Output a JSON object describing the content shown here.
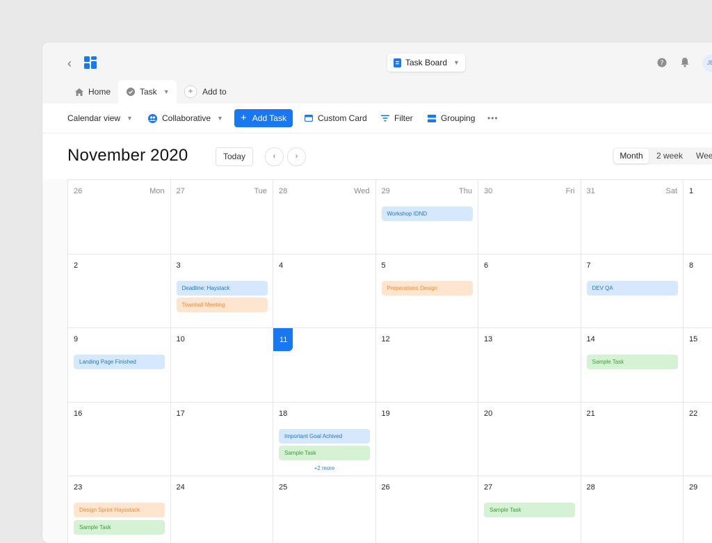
{
  "header": {
    "board_switch_label": "Task Board",
    "avatar_initials": "JB"
  },
  "tabs": {
    "home": "Home",
    "task": "Task",
    "add_to": "Add to"
  },
  "toolbar": {
    "calendar_view": "Calendar view",
    "collaborative": "Collaborative",
    "add_task": "Add Task",
    "custom_card": "Custom Card",
    "filter": "Filter",
    "grouping": "Grouping"
  },
  "calendar": {
    "title": "November 2020",
    "today_button": "Today",
    "views": [
      "Month",
      "2 week",
      "Week"
    ],
    "active_view": "Month",
    "weeks": [
      [
        {
          "day": "26",
          "name": "Mon",
          "dim": true,
          "events": []
        },
        {
          "day": "27",
          "name": "Tue",
          "dim": true,
          "events": []
        },
        {
          "day": "28",
          "name": "Wed",
          "dim": true,
          "events": []
        },
        {
          "day": "29",
          "name": "Thu",
          "dim": true,
          "events": [
            {
              "label": "Workshop IDND",
              "color": "blue"
            }
          ]
        },
        {
          "day": "30",
          "name": "Fri",
          "dim": true,
          "events": []
        },
        {
          "day": "31",
          "name": "Sat",
          "dim": true,
          "events": []
        },
        {
          "day": "1",
          "name": "",
          "dim": false,
          "events": []
        }
      ],
      [
        {
          "day": "2",
          "events": []
        },
        {
          "day": "3",
          "events": [
            {
              "label": "Deadline: Haystack",
              "color": "blue"
            },
            {
              "label": "Townhall Meeting",
              "color": "orange"
            }
          ]
        },
        {
          "day": "4",
          "events": []
        },
        {
          "day": "5",
          "events": [
            {
              "label": "Preperations Design",
              "color": "orange"
            }
          ]
        },
        {
          "day": "6",
          "events": []
        },
        {
          "day": "7",
          "events": [
            {
              "label": "DEV QA",
              "color": "blue"
            }
          ]
        },
        {
          "day": "8",
          "events": []
        }
      ],
      [
        {
          "day": "9",
          "events": [
            {
              "label": "Landing Page Finished",
              "color": "blue"
            }
          ]
        },
        {
          "day": "10",
          "events": []
        },
        {
          "day": "11",
          "today": true,
          "events": []
        },
        {
          "day": "12",
          "events": []
        },
        {
          "day": "13",
          "events": []
        },
        {
          "day": "14",
          "events": [
            {
              "label": "Sample Task",
              "color": "green"
            }
          ]
        },
        {
          "day": "15",
          "events": []
        }
      ],
      [
        {
          "day": "16",
          "events": []
        },
        {
          "day": "17",
          "events": []
        },
        {
          "day": "18",
          "events": [
            {
              "label": "Important Goal Achived",
              "color": "blue"
            },
            {
              "label": "Sample Task",
              "color": "green"
            }
          ],
          "more": "+2 more"
        },
        {
          "day": "19",
          "events": []
        },
        {
          "day": "20",
          "events": []
        },
        {
          "day": "21",
          "events": []
        },
        {
          "day": "22",
          "events": []
        }
      ],
      [
        {
          "day": "23",
          "events": [
            {
              "label": "Design Sprint Haysstack",
              "color": "orange"
            },
            {
              "label": "Sample Task",
              "color": "green"
            }
          ]
        },
        {
          "day": "24",
          "events": []
        },
        {
          "day": "25",
          "events": []
        },
        {
          "day": "26",
          "events": []
        },
        {
          "day": "27",
          "events": [
            {
              "label": "Sample Task",
              "color": "green"
            }
          ]
        },
        {
          "day": "28",
          "events": []
        },
        {
          "day": "29",
          "events": []
        }
      ]
    ]
  },
  "colors": {
    "accent": "#1877f2",
    "event_blue": "#d5e8fc",
    "event_orange": "#fde5d0",
    "event_green": "#d6f2d5"
  }
}
